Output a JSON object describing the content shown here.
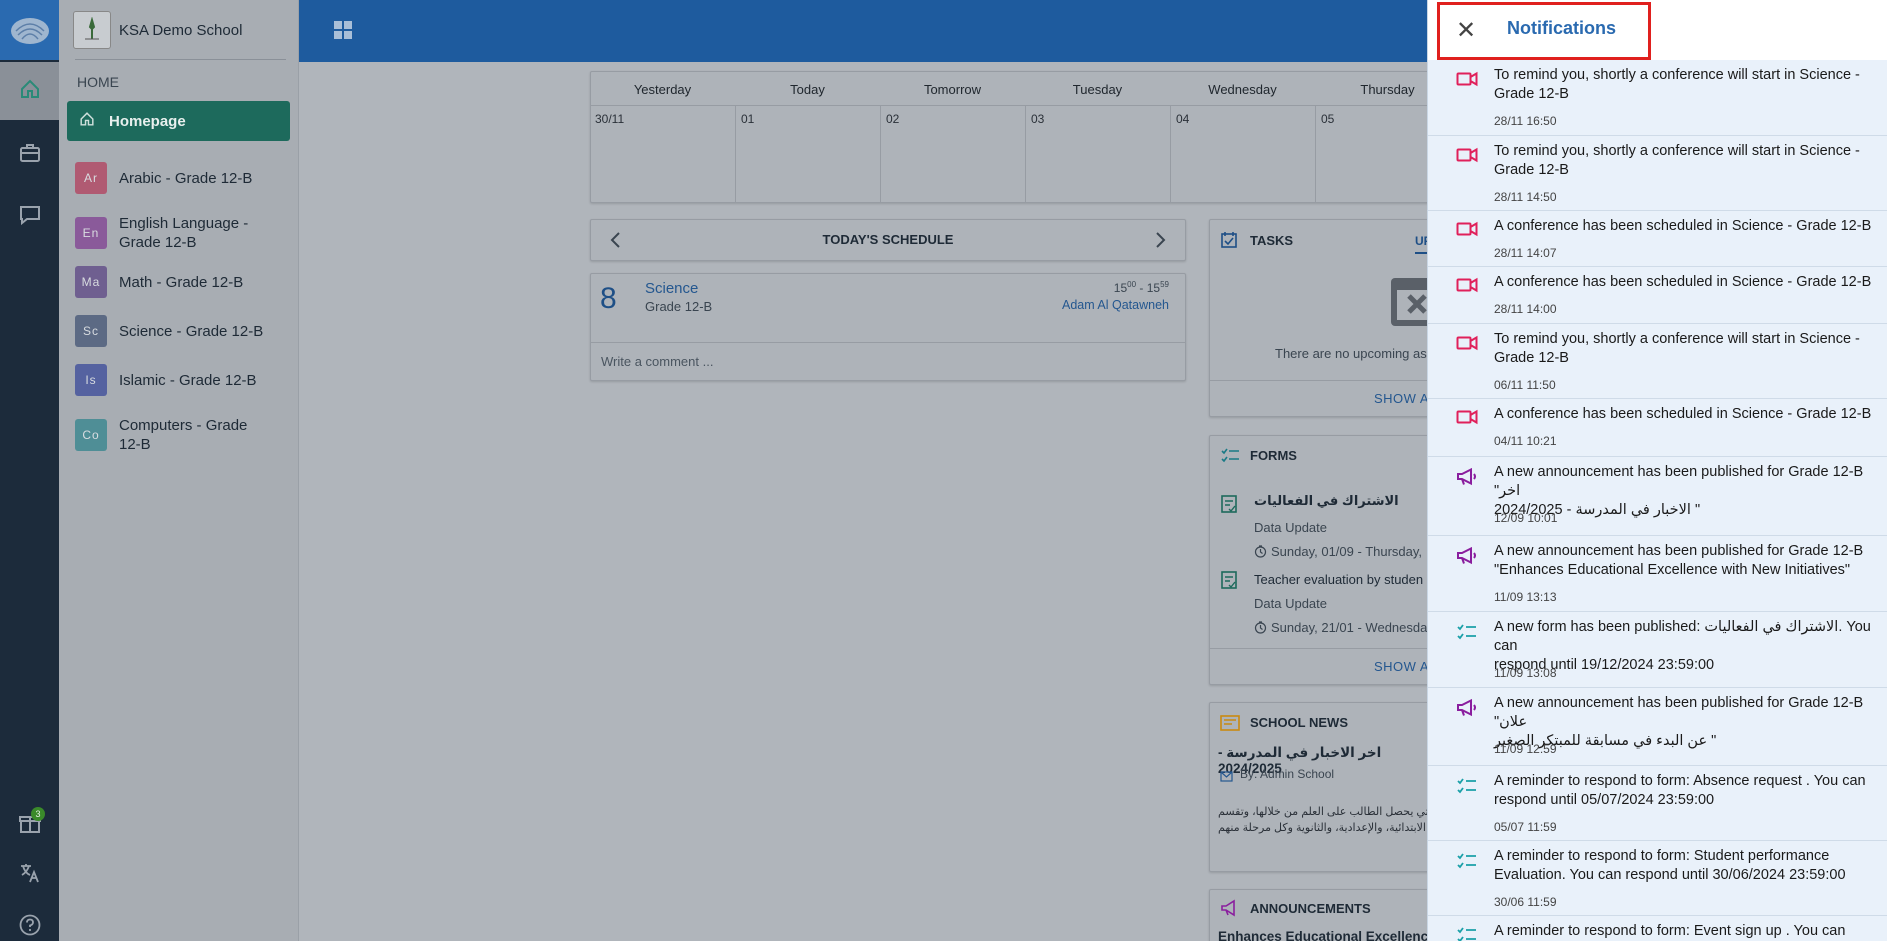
{
  "school": {
    "name": "KSA Demo School"
  },
  "rail": {
    "gift_count": "3"
  },
  "sidebar": {
    "section_label": "HOME",
    "homepage_label": "Homepage",
    "courses": [
      {
        "abbr": "Ar",
        "name": "Arabic - Grade 12-B",
        "color": "#b05a72"
      },
      {
        "abbr": "En",
        "name": "English Language - Grade 12-B",
        "color": "#8a5a9a"
      },
      {
        "abbr": "Ma",
        "name": "Math - Grade 12-B",
        "color": "#6f5f90"
      },
      {
        "abbr": "Sc",
        "name": "Science - Grade 12-B",
        "color": "#5c6a84"
      },
      {
        "abbr": "Is",
        "name": "Islamic - Grade 12-B",
        "color": "#5562a0"
      },
      {
        "abbr": "Co",
        "name": "Computers - Grade 12-B",
        "color": "#4f8e96"
      }
    ]
  },
  "calendar": {
    "days": [
      "Yesterday",
      "Today",
      "Tomorrow",
      "Tuesday",
      "Wednesday",
      "Thursday"
    ],
    "dates": [
      "30/11",
      "01",
      "02",
      "03",
      "04",
      "05"
    ]
  },
  "schedule": {
    "title": "TODAY'S SCHEDULE",
    "period": "8",
    "subject": "Science",
    "group": "Grade 12-B",
    "start_h": "15",
    "start_m": "00",
    "end_h": "15",
    "end_m": "59",
    "teacher": "Adam Al Qatawneh",
    "comment_placeholder": "Write a comment ..."
  },
  "tasks": {
    "title": "TASKS",
    "tab": "UP",
    "empty": "There are no upcoming ass",
    "show_all": "SHOW A"
  },
  "forms": {
    "title": "FORMS",
    "items": [
      {
        "title": "الاشتراك في الفعاليات",
        "type": "Data Update",
        "date": "Sunday, 01/09 - Thursday,"
      },
      {
        "title": "Teacher evaluation by studen",
        "type": "Data Update",
        "date": "Sunday, 21/01 - Wednesda"
      }
    ],
    "show_all": "SHOW A"
  },
  "news": {
    "title": "SCHOOL NEWS",
    "headline": "اخر الاخبار في المدرسة - 2024/2025",
    "author": "By: Admin School",
    "line1": "التي يحصل الطالب على العلم من خلالها، وتقسم",
    "line2": "الابتدائية، والإعدادية، والثانوية وكل مرحلة منهم"
  },
  "announcements": {
    "title": "ANNOUNCEMENTS",
    "first": "Enhances Educational Excellence"
  },
  "notifications": {
    "title": "Notifications",
    "items": [
      {
        "icon": "video-icon",
        "color": "#e0205a",
        "text": "To remind you, shortly a conference will start in Science -\nGrade 12-B",
        "time": "28/11 16:50"
      },
      {
        "icon": "video-icon",
        "color": "#e0205a",
        "text": "To remind you, shortly a conference will start in Science -\nGrade 12-B",
        "time": "28/11 14:50"
      },
      {
        "icon": "video-icon",
        "color": "#e0205a",
        "text": "A conference has been scheduled in Science - Grade 12-B",
        "time": "28/11 14:07"
      },
      {
        "icon": "video-icon",
        "color": "#e0205a",
        "text": "A conference has been scheduled in Science - Grade 12-B",
        "time": "28/11 14:00"
      },
      {
        "icon": "video-icon",
        "color": "#e0205a",
        "text": "To remind you, shortly a conference will start in Science -\nGrade 12-B",
        "time": "06/11 11:50"
      },
      {
        "icon": "video-icon",
        "color": "#e0205a",
        "text": "A conference has been scheduled in Science - Grade 12-B",
        "time": "04/11 10:21"
      },
      {
        "icon": "megaphone-icon",
        "color": "#8a1e9e",
        "text": "A new announcement has been published for Grade 12-B \"اخر\n2024/2025 - الاخبار في المدرسة \"",
        "time": "12/09 10:01"
      },
      {
        "icon": "megaphone-icon",
        "color": "#8a1e9e",
        "text": "A new announcement has been published for Grade 12-B\n\"Enhances Educational Excellence with New Initiatives\"",
        "time": "11/09 13:13"
      },
      {
        "icon": "form-icon",
        "color": "#1aa0a8",
        "text": "A new form has been published: الاشتراك في الفعاليات. You can\nrespond until 19/12/2024 23:59:00",
        "time": "11/09 13:08"
      },
      {
        "icon": "megaphone-icon",
        "color": "#8a1e9e",
        "text": "A new announcement has been published for Grade 12-B \"علان\nعن البدء في مسابقة للمبتكر الصغير \"",
        "time": "11/09 12:59"
      },
      {
        "icon": "form-icon",
        "color": "#1aa0a8",
        "text": "A reminder to respond to form: Absence request . You can\nrespond until 05/07/2024 23:59:00",
        "time": "05/07 11:59"
      },
      {
        "icon": "form-icon",
        "color": "#1aa0a8",
        "text": "A reminder to respond to form: Student performance\nEvaluation. You can respond until 30/06/2024 23:59:00",
        "time": "30/06 11:59"
      },
      {
        "icon": "form-icon",
        "color": "#1aa0a8",
        "text": "A reminder to respond to form: Event sign up . You can respon",
        "time": ""
      }
    ]
  }
}
